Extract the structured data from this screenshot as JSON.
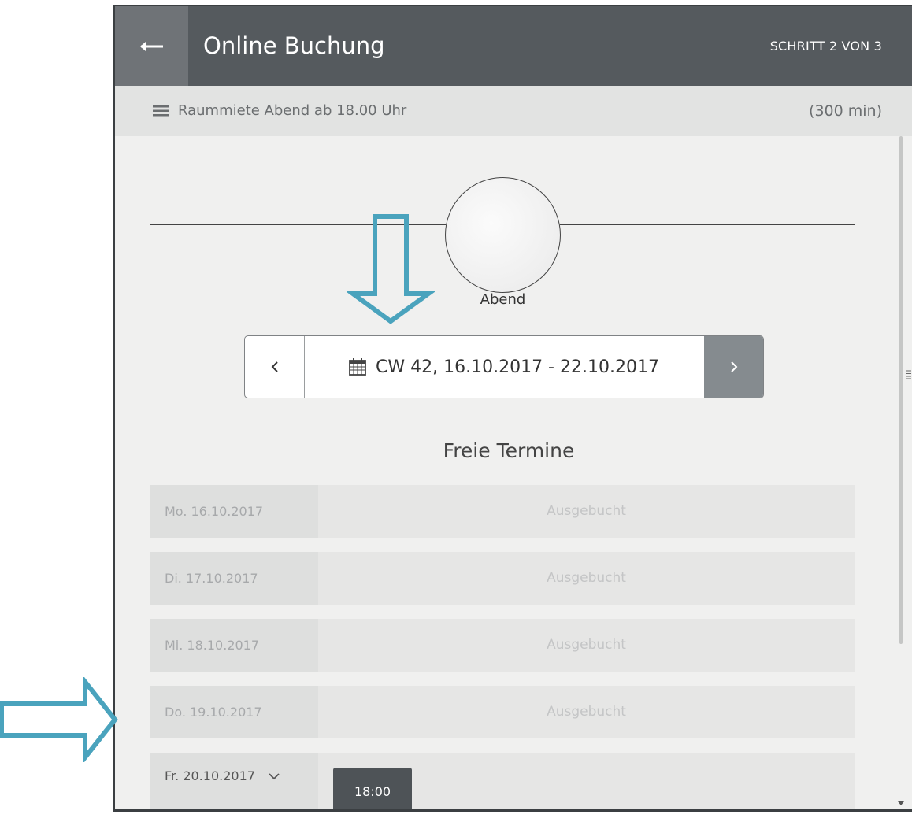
{
  "header": {
    "title": "Online Buchung",
    "step": "SCHRITT 2 VON 3",
    "back_icon": "arrow-left-icon"
  },
  "service": {
    "name": "Raummiete Abend ab 18.00 Uhr",
    "duration": "(300 min)",
    "icon": "list-icon"
  },
  "timeline": {
    "label": "Abend"
  },
  "week_nav": {
    "label": "CW 42, 16.10.2017 - 22.10.2017",
    "calendar_icon": "calendar-icon"
  },
  "section_title": "Freie Termine",
  "days": [
    {
      "date": "Mo. 16.10.2017",
      "status": "Ausgebucht"
    },
    {
      "date": "Di. 17.10.2017",
      "status": "Ausgebucht"
    },
    {
      "date": "Mi. 18.10.2017",
      "status": "Ausgebucht"
    },
    {
      "date": "Do. 19.10.2017",
      "status": "Ausgebucht"
    },
    {
      "date": "Fr. 20.10.2017",
      "slot": "18:00"
    }
  ],
  "colors": {
    "header_bg": "#555a5e",
    "annotation_arrow": "#4aa3bd"
  }
}
